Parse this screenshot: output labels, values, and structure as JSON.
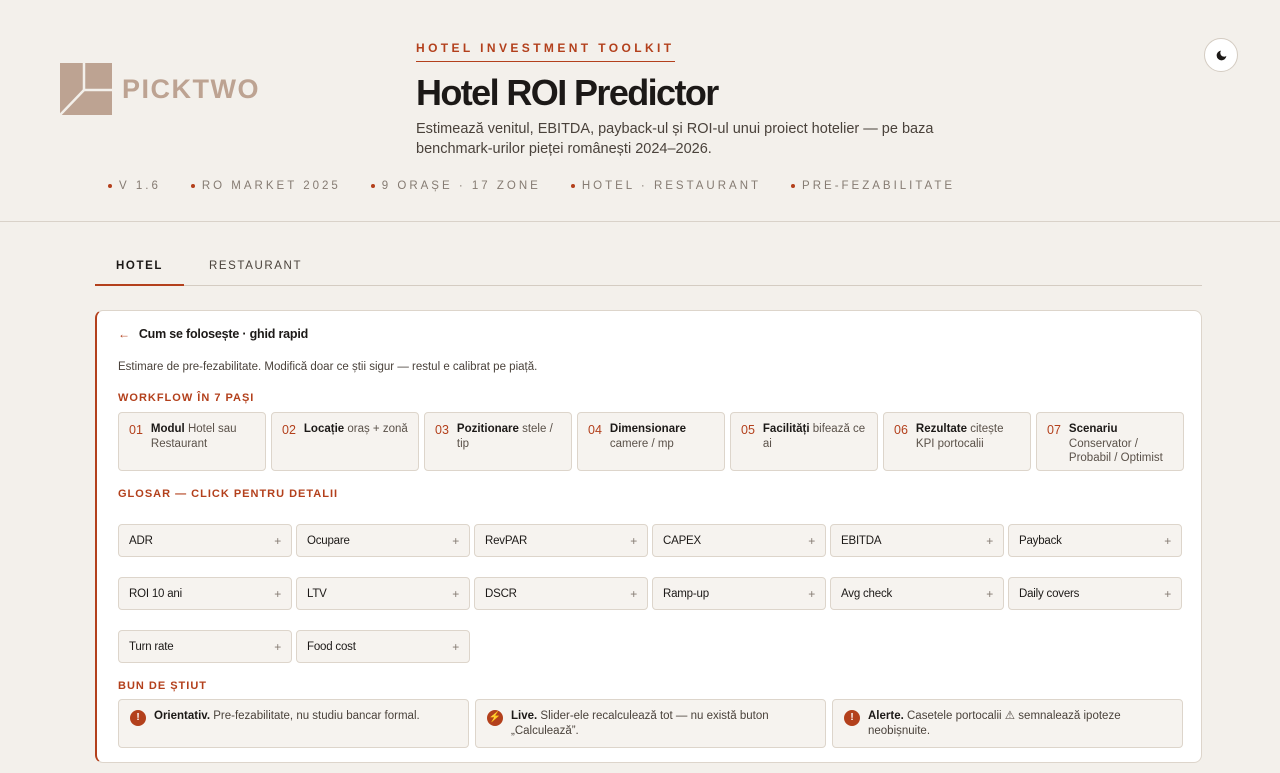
{
  "brand": {
    "name": "PICKTWO"
  },
  "header": {
    "kicker": "HOTEL INVESTMENT TOOLKIT",
    "title": "Hotel ROI Predictor",
    "subtitle": "Estimează venitul, EBITDA, payback-ul și ROI-ul unui proiect hotelier — pe baza benchmark-urilor pieței românești 2024–2026.",
    "meta": [
      "V 1.6",
      "RO MARKET 2025",
      "9 ORAȘE · 17 ZONE",
      "HOTEL · RESTAURANT",
      "PRE-FEZABILITATE"
    ],
    "theme_icon": "moon-icon"
  },
  "tabs": [
    {
      "label": "HOTEL",
      "active": true
    },
    {
      "label": "RESTAURANT",
      "active": false
    }
  ],
  "guide": {
    "title": "Cum se folosește · ghid rapid",
    "intro": "Estimare de pre-fezabilitate. Modifică doar ce știi sigur — restul e calibrat pe piață.",
    "workflow_title": "WORKFLOW ÎN 7 PAȘI",
    "steps": [
      {
        "num": "01",
        "bold": "Modul",
        "text": " Hotel sau Restaurant"
      },
      {
        "num": "02",
        "bold": "Locație",
        "text": " oraș + zonă"
      },
      {
        "num": "03",
        "bold": "Pozitionare",
        "text": " stele / tip"
      },
      {
        "num": "04",
        "bold": "Dimensionare",
        "text": " camere / mp"
      },
      {
        "num": "05",
        "bold": "Facilități",
        "text": " bifează ce ai"
      },
      {
        "num": "06",
        "bold": "Rezultate",
        "text": " citește KPI portocalii"
      },
      {
        "num": "07",
        "bold": "Scenariu",
        "text": " Conservator / Probabil / Optimist"
      }
    ],
    "glossary_title": "GLOSAR — CLICK PENTRU DETALII",
    "glossary": [
      "ADR",
      "Ocupare",
      "RevPAR",
      "CAPEX",
      "EBITDA",
      "Payback",
      "ROI 10 ani",
      "LTV",
      "DSCR",
      "Ramp-up",
      "Avg check",
      "Daily covers",
      "Turn rate",
      "Food cost"
    ],
    "good_title": "BUN DE ȘTIUT",
    "notes": [
      {
        "icon": "!",
        "bold": "Orientativ.",
        "text": " Pre-fezabilitate, nu studiu bancar formal."
      },
      {
        "icon": "⚡",
        "bold": "Live.",
        "text": " Slider-ele recalculează tot — nu există buton „Calculează”."
      },
      {
        "icon": "!",
        "bold": "Alerte.",
        "text": " Casetele portocalii ⚠ semnalează ipoteze neobișnuite."
      }
    ]
  },
  "colors": {
    "accent": "#b3401c",
    "background": "#f3f0eb",
    "logo": "#bda392"
  }
}
